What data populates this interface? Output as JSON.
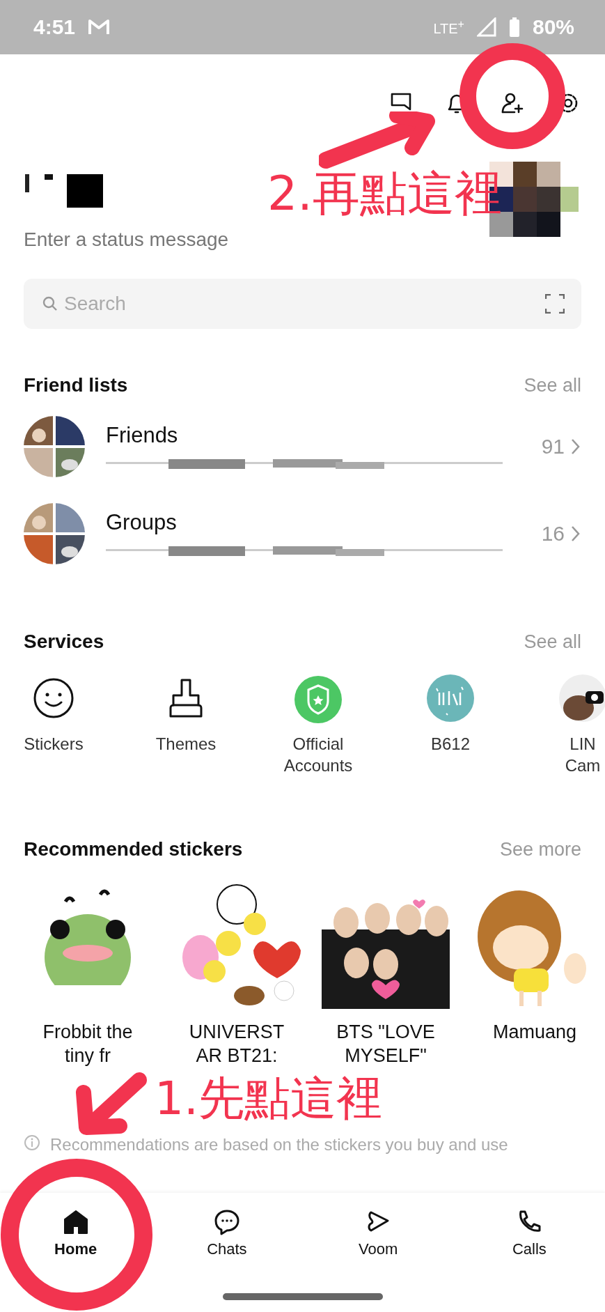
{
  "status_bar": {
    "time": "4:51",
    "network": "LTE$^{+}$",
    "battery": "80%"
  },
  "profile": {
    "status_placeholder": "Enter a status message"
  },
  "search": {
    "placeholder": "Search"
  },
  "friend_lists": {
    "title": "Friend lists",
    "see_all": "See all",
    "items": [
      {
        "name": "Friends",
        "count": "91"
      },
      {
        "name": "Groups",
        "count": "16"
      }
    ]
  },
  "services": {
    "title": "Services",
    "see_all": "See all",
    "items": [
      {
        "label": "Stickers",
        "kind": "smiley"
      },
      {
        "label": "Themes",
        "kind": "brush"
      },
      {
        "label": "Official\nAccounts",
        "kind": "shield"
      },
      {
        "label": "B612",
        "kind": "b612"
      },
      {
        "label": "LIN\nCam",
        "kind": "camera"
      }
    ]
  },
  "recommended_stickers": {
    "title": "Recommended stickers",
    "see_more": "See more",
    "items": [
      {
        "name": "Frobbit the\ntiny fr",
        "kind": "picture"
      },
      {
        "name": "UNIVERST\nAR BT21:",
        "kind": "picture"
      },
      {
        "name": "BTS \"LOVE\nMYSELF\"",
        "kind": "picture"
      },
      {
        "name": "Mamuang",
        "kind": "picture"
      }
    ],
    "note": "Recommendations are based on the stickers you buy and use"
  },
  "nav": [
    {
      "label": "Home",
      "selected": true
    },
    {
      "label": "Chats",
      "selected": false
    },
    {
      "label": "Voom",
      "selected": false
    },
    {
      "label": "Calls",
      "selected": false
    }
  ],
  "annotations": [
    {
      "text": "2.再點這裡"
    },
    {
      "text": "1.先點這裡"
    }
  ]
}
